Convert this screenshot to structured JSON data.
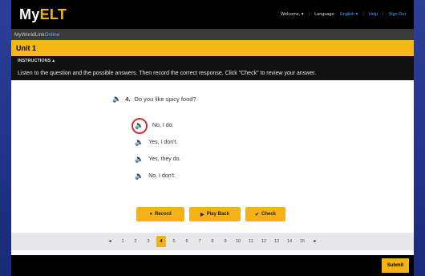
{
  "header": {
    "logo_prefix": "My",
    "logo_main": "ELT",
    "welcome": "Welcome, ▾",
    "language_label": "Language:",
    "language_value": "English ▾",
    "help": "Help",
    "signout": "Sign Out"
  },
  "subbar": {
    "prefix": "MyWorldLink",
    "suffix": "Online"
  },
  "unit": {
    "title": "Unit 1"
  },
  "instructions": {
    "heading": "INSTRUCTIONS",
    "toggle_icon": "caret-up",
    "text": "Listen to the question and the possible answers. Then record the correct response. Click \"Check\" to review your answer."
  },
  "question": {
    "number": "4.",
    "text": "Do you like spicy food?",
    "audio_icon": "speaker-icon"
  },
  "answers": [
    {
      "text": "No, I do."
    },
    {
      "text": "Yes, I don't."
    },
    {
      "text": "Yes, they do."
    },
    {
      "text": "No, I don't."
    }
  ],
  "buttons": {
    "record": "Record",
    "playback": "Play Back",
    "check": "Check"
  },
  "pager": {
    "prev": "◄",
    "next": "►",
    "pages": [
      "1",
      "2",
      "3",
      "4",
      "5",
      "6",
      "7",
      "8",
      "9",
      "10",
      "11",
      "12",
      "13",
      "14",
      "15"
    ],
    "active": "4"
  },
  "footer": {
    "submit": "Submit"
  },
  "colors": {
    "accent": "#f3b21a",
    "topbar": "#000000",
    "highlight_ring": "#d32f2f",
    "link": "#4ea3ff"
  }
}
